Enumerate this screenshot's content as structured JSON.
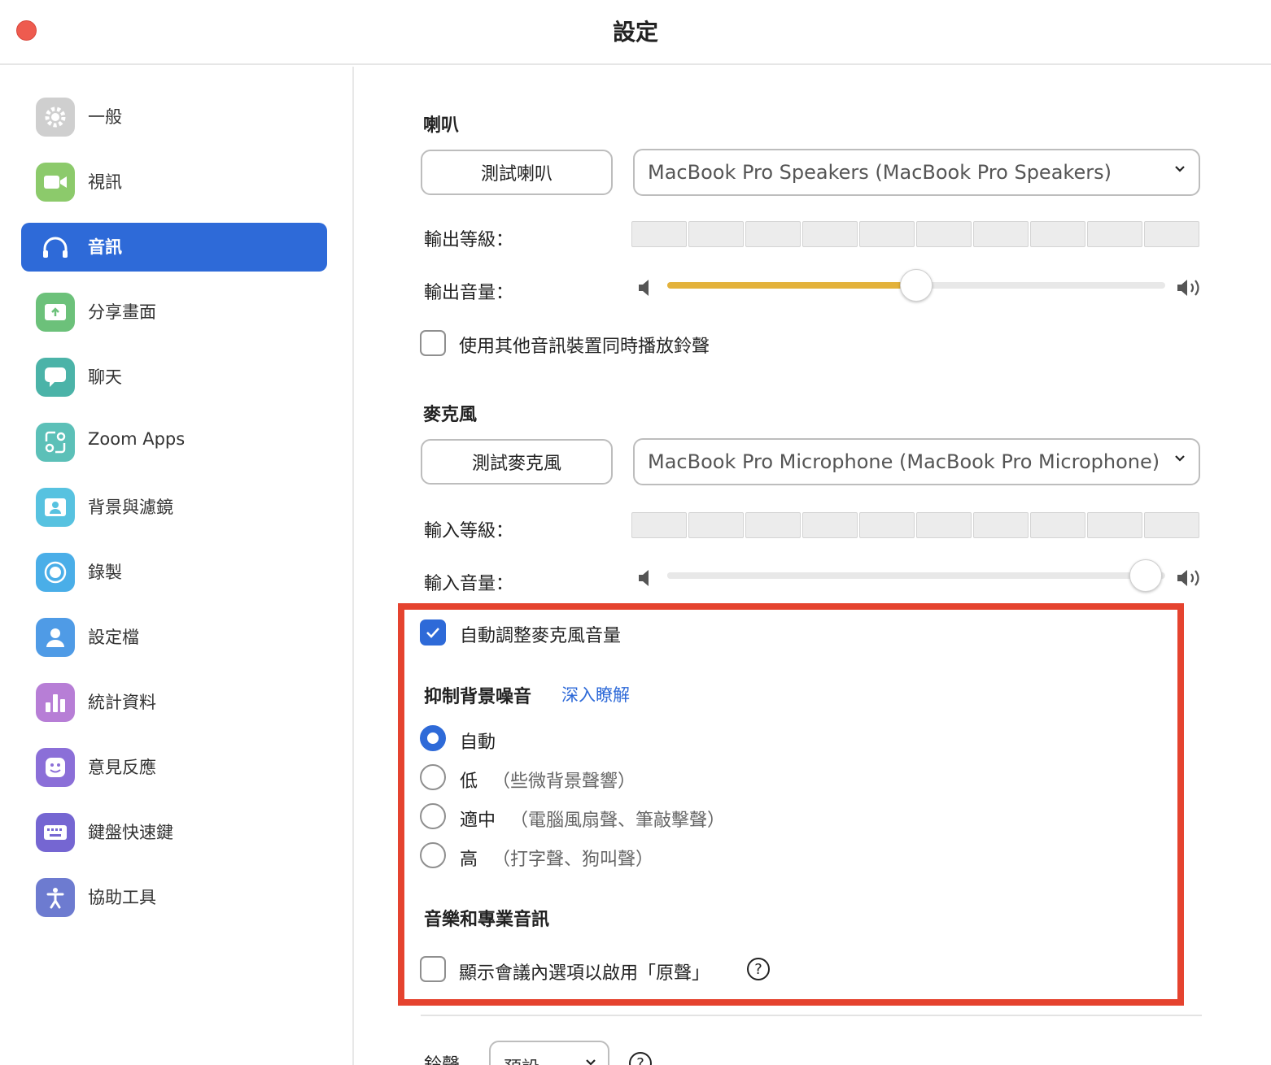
{
  "window": {
    "title": "設定"
  },
  "sidebar": {
    "items": [
      {
        "label": "一般",
        "icon": "gear-icon",
        "color": "#c8c8c8"
      },
      {
        "label": "視訊",
        "icon": "video-camera-icon",
        "color": "#8cca6b"
      },
      {
        "label": "音訊",
        "icon": "headphones-icon",
        "color": "#2e6ad8",
        "active": true
      },
      {
        "label": "分享畫面",
        "icon": "share-screen-icon",
        "color": "#6cc17a"
      },
      {
        "label": "聊天",
        "icon": "chat-bubble-icon",
        "color": "#4bb3a8"
      },
      {
        "label": "Zoom Apps",
        "icon": "apps-icon",
        "color": "#5cc0b8"
      },
      {
        "label": "背景與濾鏡",
        "icon": "background-portrait-icon",
        "color": "#57c2e0"
      },
      {
        "label": "錄製",
        "icon": "record-icon",
        "color": "#4aaee8"
      },
      {
        "label": "設定檔",
        "icon": "profile-icon",
        "color": "#4f9be6"
      },
      {
        "label": "統計資料",
        "icon": "statistics-icon",
        "color": "#b77ed6"
      },
      {
        "label": "意見反應",
        "icon": "feedback-smile-icon",
        "color": "#8b6fd8"
      },
      {
        "label": "鍵盤快速鍵",
        "icon": "keyboard-icon",
        "color": "#7566d2"
      },
      {
        "label": "協助工具",
        "icon": "accessibility-icon",
        "color": "#6d7bd0"
      }
    ]
  },
  "speaker": {
    "section_title": "喇叭",
    "test_button": "測試喇叭",
    "device": "MacBook Pro Speakers (MacBook Pro Speakers)",
    "output_level_label": "輸出等級：",
    "output_level": 0,
    "output_volume_label": "輸出音量：",
    "output_volume": 0.5,
    "ring_checkbox_label": "使用其他音訊裝置同時播放鈴聲",
    "ring_checkbox_checked": false
  },
  "microphone": {
    "section_title": "麥克風",
    "test_button": "測試麥克風",
    "device": "MacBook Pro Microphone (MacBook Pro Microphone)",
    "input_level_label": "輸入等級：",
    "input_level": 0,
    "input_volume_label": "輸入音量：",
    "input_volume": 0.96,
    "auto_adjust_label": "自動調整麥克風音量",
    "auto_adjust_checked": true
  },
  "noise_suppression": {
    "title": "抑制背景噪音",
    "learn_more": "深入瞭解",
    "options": [
      {
        "label": "自動",
        "desc": "",
        "selected": true
      },
      {
        "label": "低",
        "desc": "（些微背景聲響）",
        "selected": false
      },
      {
        "label": "適中",
        "desc": "（電腦風扇聲、筆敲擊聲）",
        "selected": false
      },
      {
        "label": "高",
        "desc": "（打字聲、狗叫聲）",
        "selected": false
      }
    ]
  },
  "music_audio": {
    "title": "音樂和專業音訊",
    "original_sound_label": "顯示會議內選項以啟用「原聲」",
    "original_sound_checked": false,
    "help": "?"
  },
  "ringtone": {
    "label": "鈴聲",
    "value": "預設",
    "help": "?"
  },
  "colors": {
    "accent": "#2e6ad8",
    "highlight": "#e5432f",
    "slider_fill": "#e3b23c"
  }
}
